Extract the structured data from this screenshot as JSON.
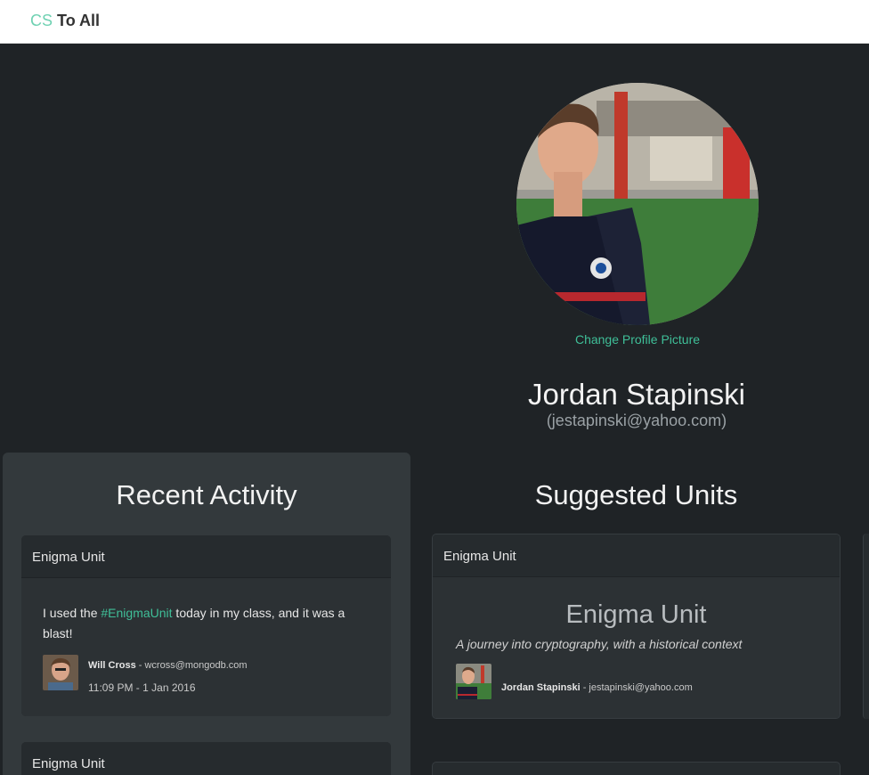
{
  "brand": {
    "prefix": "CS",
    "suffix": "To All"
  },
  "profile": {
    "change_picture_label": "Change Profile Picture",
    "name": "Jordan Stapinski",
    "email": "(jestapinski@yahoo.com)"
  },
  "activity": {
    "title": "Recent Activity",
    "items": [
      {
        "header": "Enigma Unit",
        "text_before": "I used the ",
        "hashtag": "#EnigmaUnit",
        "text_after": " today in my class, and it was a blast!",
        "author_name": "Will Cross",
        "author_email": " - wcross@mongodb.com",
        "timestamp": "11:09 PM - 1 Jan 2016"
      },
      {
        "header": "Enigma Unit"
      }
    ]
  },
  "units": {
    "title": "Suggested Units",
    "items": [
      {
        "header": "Enigma Unit",
        "name": "Enigma Unit",
        "description": "A journey into cryptography, with a historical context",
        "author_name": "Jordan Stapinski",
        "author_email": " - jestapinski@yahoo.com"
      }
    ]
  }
}
